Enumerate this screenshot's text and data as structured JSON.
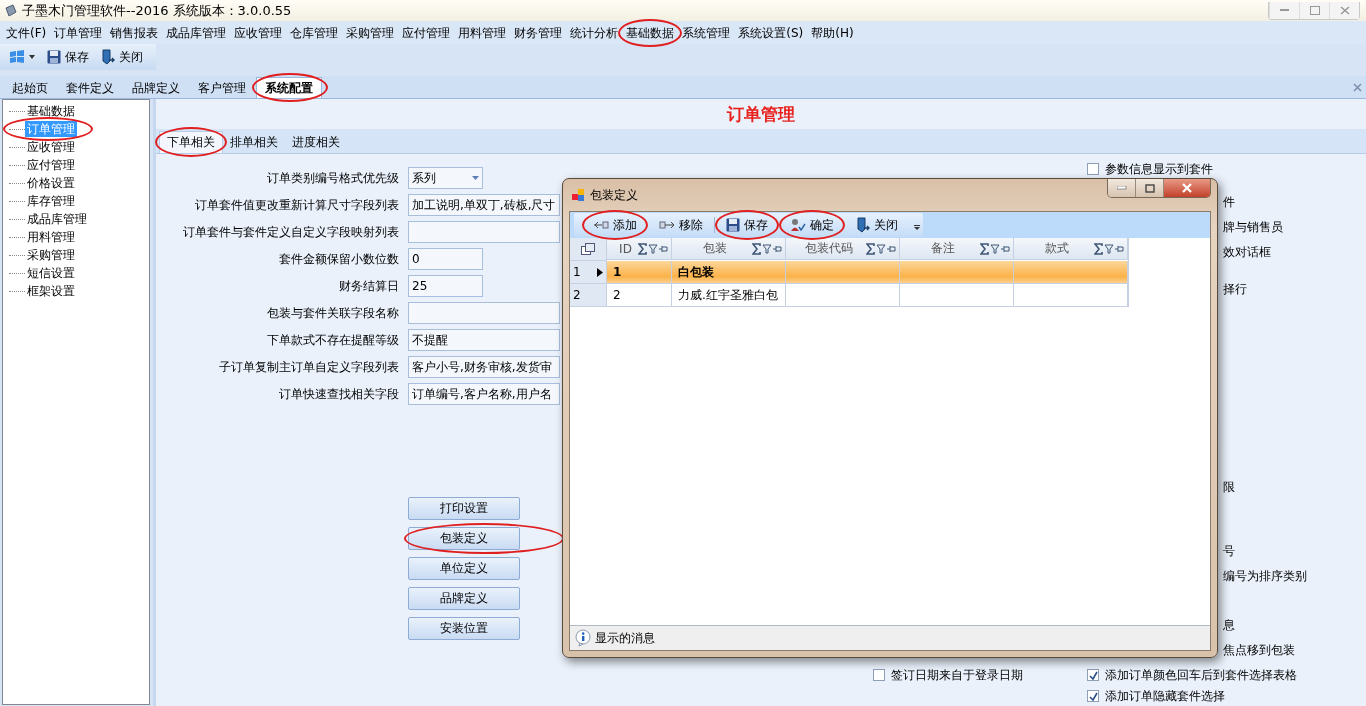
{
  "window": {
    "title": "子墨木门管理软件--2016 系统版本：3.0.0.55"
  },
  "menu": [
    {
      "label": "文件(F)",
      "circled": false
    },
    {
      "label": "订单管理",
      "circled": false
    },
    {
      "label": "销售报表",
      "circled": false
    },
    {
      "label": "成品库管理",
      "circled": false
    },
    {
      "label": "应收管理",
      "circled": false
    },
    {
      "label": "仓库管理",
      "circled": false
    },
    {
      "label": "采购管理",
      "circled": false
    },
    {
      "label": "应付管理",
      "circled": false
    },
    {
      "label": "用料管理",
      "circled": false
    },
    {
      "label": "财务管理",
      "circled": false
    },
    {
      "label": "统计分析",
      "circled": false
    },
    {
      "label": "基础数据",
      "circled": true
    },
    {
      "label": "系统管理",
      "circled": false
    },
    {
      "label": "系统设置(S)",
      "circled": false
    },
    {
      "label": "帮助(H)",
      "circled": false
    }
  ],
  "toolbar": [
    {
      "kind": "start-menu"
    },
    {
      "kind": "save",
      "label": "保存"
    },
    {
      "kind": "close",
      "label": "关闭"
    }
  ],
  "tabs": [
    {
      "label": "起始页",
      "selected": false,
      "circled": false
    },
    {
      "label": "套件定义",
      "selected": false,
      "circled": false
    },
    {
      "label": "品牌定义",
      "selected": false,
      "circled": false
    },
    {
      "label": "客户管理",
      "selected": false,
      "circled": false
    },
    {
      "label": "系统配置",
      "selected": true,
      "circled": true
    }
  ],
  "tree": [
    {
      "label": "基础数据",
      "selected": false,
      "circled": false
    },
    {
      "label": "订单管理",
      "selected": true,
      "circled": true
    },
    {
      "label": "应收管理",
      "selected": false,
      "circled": false
    },
    {
      "label": "应付管理",
      "selected": false,
      "circled": false
    },
    {
      "label": "价格设置",
      "selected": false,
      "circled": false
    },
    {
      "label": "库存管理",
      "selected": false,
      "circled": false
    },
    {
      "label": "成品库管理",
      "selected": false,
      "circled": false
    },
    {
      "label": "用料管理",
      "selected": false,
      "circled": false
    },
    {
      "label": "采购管理",
      "selected": false,
      "circled": false
    },
    {
      "label": "短信设置",
      "selected": false,
      "circled": false
    },
    {
      "label": "框架设置",
      "selected": false,
      "circled": false
    }
  ],
  "page": {
    "title": "订单管理",
    "subtabs": [
      {
        "label": "下单相关",
        "selected": true,
        "circled": true
      },
      {
        "label": "排单相关",
        "selected": false,
        "circled": false
      },
      {
        "label": "进度相关",
        "selected": false,
        "circled": false
      }
    ],
    "fields": [
      {
        "label": "订单类别编号格式优先级",
        "kind": "combo",
        "value": "系列"
      },
      {
        "label": "订单套件值更改重新计算尺寸字段列表",
        "kind": "long",
        "value": "加工说明,单双丁,砖板,尺寸"
      },
      {
        "label": "订单套件与套件定义自定义字段映射列表",
        "kind": "long"
      },
      {
        "label": "套件金额保留小数位数",
        "kind": "short",
        "value": "0"
      },
      {
        "label": "财务结算日",
        "kind": "short",
        "value": "25"
      },
      {
        "label": "包装与套件关联字段名称",
        "kind": "long"
      },
      {
        "label": "下单款式不存在提醒等级",
        "kind": "long",
        "value": "不提醒"
      },
      {
        "label": "子订单复制主订单自定义字段列表",
        "kind": "long",
        "value": "客户小号,财务审核,发货审"
      },
      {
        "label": "订单快速查找相关字段",
        "kind": "long",
        "value": "订单编号,客户名称,用户名"
      }
    ],
    "buttons": [
      {
        "label": "打印设置",
        "circled": false
      },
      {
        "label": "包装定义",
        "circled": true
      },
      {
        "label": "单位定义",
        "circled": false
      },
      {
        "label": "品牌定义",
        "circled": false
      },
      {
        "label": "安装位置",
        "circled": false
      }
    ],
    "middle_options": [
      {
        "label": "签订日期来自于登录日期",
        "checked": false
      }
    ],
    "right_options": [
      {
        "kind": "checkbox",
        "label": "参数信息显示到套件",
        "checked": false
      },
      {
        "kind": "fragment",
        "label": "件"
      },
      {
        "kind": "fragment",
        "label": "牌与销售员"
      },
      {
        "kind": "fragment",
        "label": "效对话框"
      },
      {
        "kind": "fragment",
        "label": "择行"
      },
      {
        "kind": "fragment",
        "label": "限"
      },
      {
        "kind": "fragment",
        "label": "号"
      },
      {
        "kind": "fragment",
        "label": "编号为排序类别"
      },
      {
        "kind": "fragment",
        "label": "息"
      },
      {
        "kind": "fragment",
        "label": "焦点移到包装"
      },
      {
        "kind": "checkbox",
        "label": "添加订单颜色回车后到套件选择表格",
        "checked": true
      },
      {
        "kind": "checkbox",
        "label": "添加订单隐藏套件选择",
        "checked": true
      }
    ]
  },
  "dialog": {
    "title": "包装定义",
    "toolbar": [
      {
        "kind": "add",
        "label": "添加",
        "circled": true
      },
      {
        "kind": "remove",
        "label": "移除",
        "circled": false
      },
      {
        "kind": "save",
        "label": "保存",
        "circled": true
      },
      {
        "kind": "confirm",
        "label": "确定",
        "circled": true
      },
      {
        "kind": "close",
        "label": "关闭",
        "circled": false
      }
    ],
    "columns": [
      "ID",
      "包装",
      "包装代码",
      "备注",
      "款式"
    ],
    "rows": [
      {
        "number": "1",
        "selected": true,
        "cells": [
          "1",
          "白包装"
        ]
      },
      {
        "number": "2",
        "selected": false,
        "cells": [
          "2",
          "力威.红宇圣雅白包"
        ]
      }
    ],
    "status": "显示的消息"
  }
}
